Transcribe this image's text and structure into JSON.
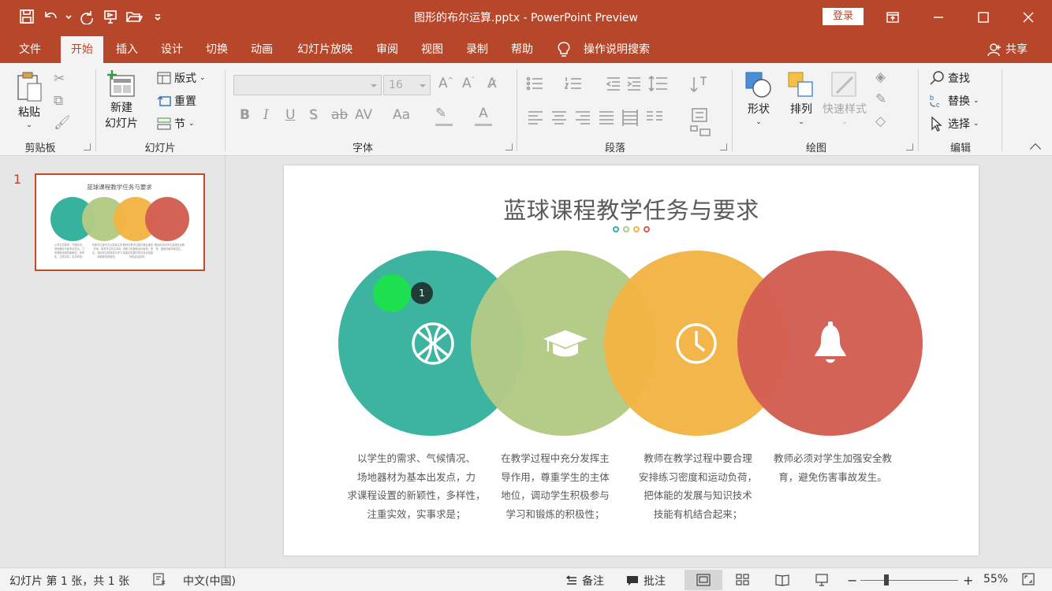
{
  "window": {
    "title": "图形的布尔运算.pptx  -  PowerPoint Preview",
    "login_label": "登录"
  },
  "tabs": [
    {
      "label": "文件"
    },
    {
      "label": "开始"
    },
    {
      "label": "插入"
    },
    {
      "label": "设计"
    },
    {
      "label": "切换"
    },
    {
      "label": "动画"
    },
    {
      "label": "幻灯片放映"
    },
    {
      "label": "审阅"
    },
    {
      "label": "视图"
    },
    {
      "label": "录制"
    },
    {
      "label": "帮助"
    }
  ],
  "tell_me": "操作说明搜索",
  "share_label": "共享",
  "ribbon": {
    "clipboard": {
      "paste": "粘贴",
      "group": "剪贴板"
    },
    "slides": {
      "new_slide_line1": "新建",
      "new_slide_line2": "幻灯片",
      "layout": "版式",
      "reset": "重置",
      "section": "节",
      "group": "幻灯片"
    },
    "font": {
      "size": "16",
      "group": "字体",
      "bold": "B",
      "italic": "I",
      "underline": "U",
      "shadow": "S",
      "strike": "ab",
      "spacing": "AV",
      "case": "Aa",
      "color": "A"
    },
    "paragraph": {
      "group": "段落"
    },
    "drawing": {
      "shapes": "形状",
      "arrange": "排列",
      "quick_styles": "快速样式",
      "group": "绘图"
    },
    "editing": {
      "find": "查找",
      "replace": "替换",
      "select": "选择",
      "group": "编辑"
    }
  },
  "thumbnail": {
    "number": "1",
    "title": "蓝球课程教学任务与要求",
    "texts": [
      "以学生的需求、气候情况、场地器材为基本出发点，力求课程设置的新颖性，多样性，注重实效，实事求是；",
      "在教学过程中充分发挥主导作用，尊重学生的主体地位，调动学生积极参与学习和锻炼的积极性；",
      "教师在教学过程中要合理安排练习密度和运动负荷，把体能的发展与知识技术技能有机结合起来；",
      "教师必须对学生加强安全教育，避免伤害事故发生。"
    ]
  },
  "slide": {
    "title": "蓝球课程教学任务与要求",
    "step_badge": "1",
    "colors": {
      "teal": "#36b29d",
      "green": "#b3ca85",
      "orange": "#f3b444",
      "red": "#d35e52"
    },
    "items": [
      {
        "icon": "basketball-icon",
        "lines": [
          "以学生的需求、气候情况、",
          "场地器材为基本出发点，力",
          "求课程设置的新颖性，多样性，",
          "注重实效，实事求是；"
        ]
      },
      {
        "icon": "graduation-cap-icon",
        "lines": [
          "在教学过程中充分发挥主",
          "导作用，尊重学生的主体",
          "地位，调动学生积极参与",
          "学习和锻炼的积极性；"
        ]
      },
      {
        "icon": "clock-icon",
        "lines": [
          "教师在教学过程中要合理",
          "安排练习密度和运动负荷，",
          "把体能的发展与知识技术",
          "技能有机结合起来；"
        ]
      },
      {
        "icon": "bell-icon",
        "lines": [
          "教师必须对学生加强安全教",
          "育，避免伤害事故发生。"
        ]
      }
    ]
  },
  "status": {
    "slide_info": "幻灯片 第 1 张，共 1 张",
    "language": "中文(中国)",
    "notes": "备注",
    "comments": "批注",
    "zoom": "55%"
  }
}
